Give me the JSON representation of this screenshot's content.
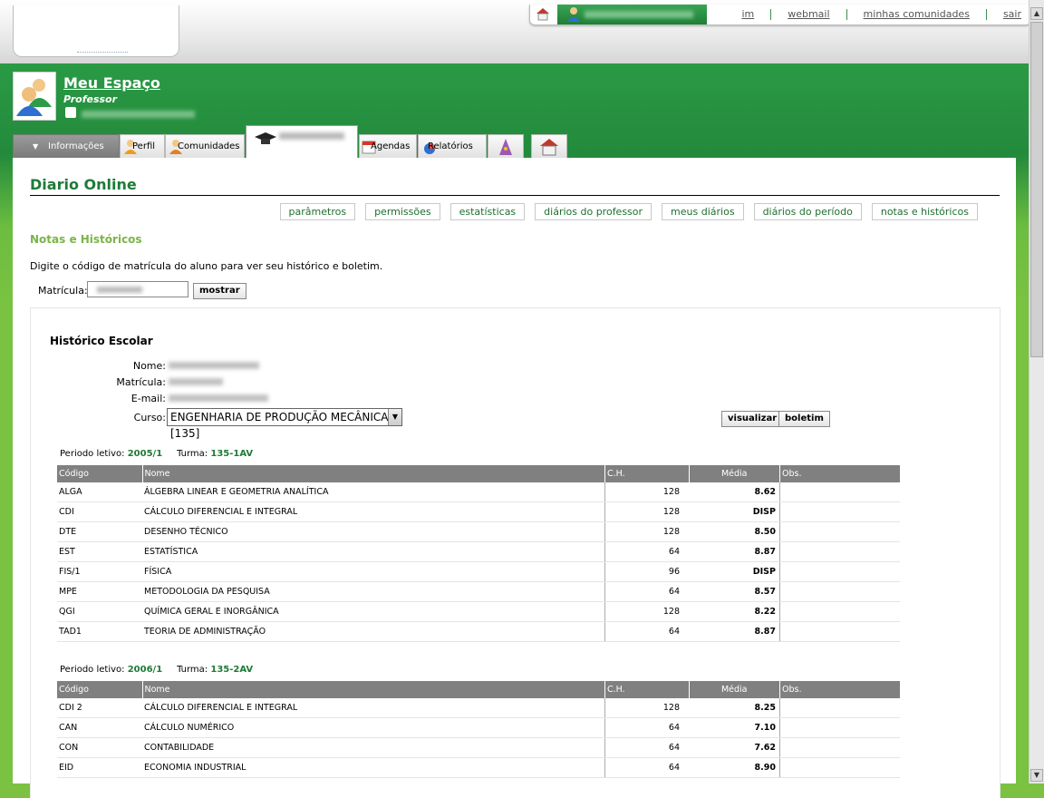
{
  "topbar": {
    "links": [
      "im",
      "webmail",
      "minhas comunidades",
      "sair"
    ]
  },
  "space": {
    "title": "Meu Espaço",
    "role": "Professor"
  },
  "tabs": {
    "info": "Informações",
    "perfil": "Perfil",
    "comunidades": "Comunidades",
    "agendas": "Agendas",
    "relatorios": "Relatórios"
  },
  "page": {
    "title": "Diario Online",
    "buttons": [
      "parâmetros",
      "permissões",
      "estatísticas",
      "diários do professor",
      "meus diários",
      "diários do período",
      "notas e históricos"
    ],
    "section": "Notas e Históricos",
    "instruction": "Digite o código de matrícula do aluno para ver seu histórico e boletim.",
    "matricula_label": "Matrícula:",
    "mostrar": "mostrar"
  },
  "historico": {
    "title": "Histórico Escolar",
    "labels": {
      "nome": "Nome:",
      "matricula": "Matrícula:",
      "email": "E-mail:",
      "curso": "Curso:"
    },
    "curso_value": "ENGENHARIA DE PRODUÇÃO MECÂNICA [135]",
    "visualizar": "visualizar",
    "boletim": "boletim"
  },
  "columns": [
    "Código",
    "Nome",
    "C.H.",
    "Média",
    "Obs."
  ],
  "periods": [
    {
      "periodo_label": "Periodo letivo:",
      "periodo": "2005/1",
      "turma_label": "Turma:",
      "turma": "135-1AV",
      "rows": [
        [
          "ALGA",
          "ÁLGEBRA LINEAR E GEOMETRIA ANALÍTICA",
          "128",
          "8.62"
        ],
        [
          "CDI",
          "CÁLCULO DIFERENCIAL E INTEGRAL",
          "128",
          "DISP"
        ],
        [
          "DTE",
          "DESENHO TÉCNICO",
          "128",
          "8.50"
        ],
        [
          "EST",
          "ESTATÍSTICA",
          "64",
          "8.87"
        ],
        [
          "FIS/1",
          "FÍSICA",
          "96",
          "DISP"
        ],
        [
          "MPE",
          "METODOLOGIA DA PESQUISA",
          "64",
          "8.57"
        ],
        [
          "QGI",
          "QUÍMICA GERAL E INORGÂNICA",
          "128",
          "8.22"
        ],
        [
          "TAD1",
          "TEORIA DE ADMINISTRAÇÃO",
          "64",
          "8.87"
        ]
      ]
    },
    {
      "periodo_label": "Periodo letivo:",
      "periodo": "2006/1",
      "turma_label": "Turma:",
      "turma": "135-2AV",
      "rows": [
        [
          "CDI 2",
          "CÁLCULO DIFERENCIAL E INTEGRAL",
          "128",
          "8.25"
        ],
        [
          "CAN",
          "CÁLCULO NUMÉRICO",
          "64",
          "7.10"
        ],
        [
          "CON",
          "CONTABILIDADE",
          "64",
          "7.62"
        ],
        [
          "EID",
          "ECONOMIA INDUSTRIAL",
          "64",
          "8.90"
        ]
      ]
    }
  ]
}
